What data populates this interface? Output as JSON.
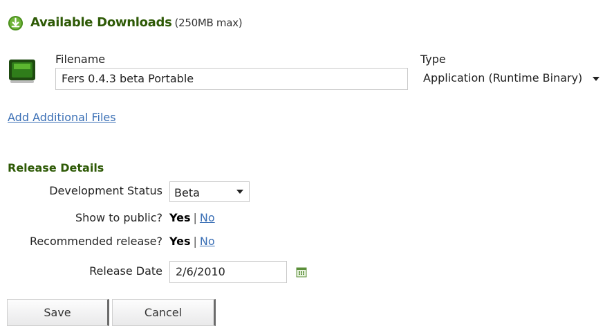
{
  "header": {
    "title": "Available Downloads",
    "subtitle": "(250MB max)",
    "icon": "download-icon",
    "accent": "#2e5a06"
  },
  "file": {
    "thumb_icon": "package-icon",
    "filename_label": "Filename",
    "filename_value": "Fers 0.4.3 beta Portable",
    "type_label": "Type",
    "type_value": "Application (Runtime Binary)"
  },
  "add_files_link": "Add Additional Files",
  "release": {
    "section_title": "Release Details",
    "dev_status_label": "Development Status",
    "dev_status_value": "Beta",
    "public_label": "Show to public?",
    "public_yes": "Yes",
    "public_sep": "|",
    "public_no": "No",
    "recommended_label": "Recommended release?",
    "recommended_yes": "Yes",
    "recommended_sep": "|",
    "recommended_no": "No",
    "date_label": "Release Date",
    "date_value": "2/6/2010",
    "calendar_icon": "calendar-icon"
  },
  "buttons": {
    "save": "Save",
    "cancel": "Cancel"
  },
  "colors": {
    "link": "#3a6fb5",
    "section": "#2e5a06"
  }
}
